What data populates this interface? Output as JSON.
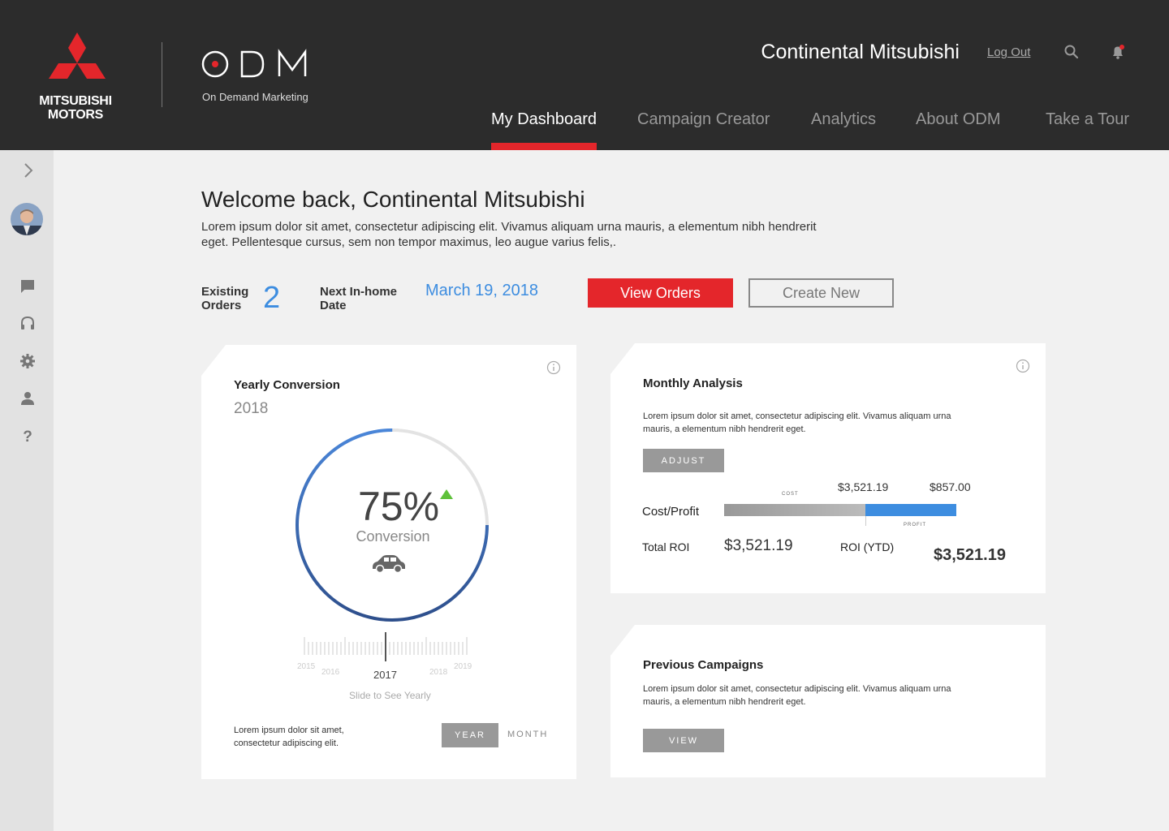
{
  "header": {
    "brand_line1": "MITSUBISHI",
    "brand_line2": "MOTORS",
    "product_tagline": "On Demand Marketing",
    "dealer_name": "Continental Mitsubishi",
    "logout_label": "Log Out",
    "icons": [
      "search-icon",
      "bell-icon"
    ],
    "nav": [
      {
        "label": "My Dashboard",
        "active": true
      },
      {
        "label": "Campaign Creator",
        "active": false
      },
      {
        "label": "Analytics",
        "active": false
      },
      {
        "label": "About ODM",
        "active": false
      },
      {
        "label": "Take a Tour",
        "active": false
      }
    ]
  },
  "sidebar": {
    "icons": [
      "chevron-right-icon",
      "avatar",
      "chat-icon",
      "headset-icon",
      "gear-icon",
      "user-icon",
      "help-icon"
    ]
  },
  "welcome": {
    "title": "Welcome back, Continental Mitsubishi",
    "description": "Lorem ipsum dolor sit amet, consectetur adipiscing elit. Vivamus aliquam urna mauris, a elementum nibh hendrerit eget. Pellentesque cursus, sem non tempor maximus, leo augue varius felis,."
  },
  "stats": {
    "existing_label_1": "Existing",
    "existing_label_2": "Orders",
    "existing_value": "2",
    "next_label_1": "Next In-home",
    "next_label_2": "Date",
    "next_value": "March 19, 2018",
    "view_orders": "View Orders",
    "create_new": "Create New"
  },
  "yearly": {
    "title": "Yearly Conversion",
    "year": "2018",
    "percent": "75%",
    "percent_value": 75,
    "label": "Conversion",
    "slider_years": [
      "2015",
      "2016",
      "2017",
      "2018",
      "2019"
    ],
    "selected_year": "2017",
    "hint": "Slide to See Yearly",
    "footer_text_1": "Lorem ipsum dolor sit amet,",
    "footer_text_2": "consectetur adipiscing elit.",
    "toggle_year": "YEAR",
    "toggle_month": "MONTH"
  },
  "monthly": {
    "title": "Monthly Analysis",
    "desc_1": "Lorem ipsum dolor sit amet, consectetur adipiscing elit. Vivamus aliquam urna",
    "desc_2": "mauris, a elementum nibh hendrerit eget.",
    "adjust": "ADJUST",
    "cost_tag": "COST",
    "profit_tag": "PROFIT",
    "cost_value": "$3,521.19",
    "profit_value": "$857.00",
    "cost_profit_label": "Cost/Profit",
    "total_roi_label": "Total ROI",
    "total_roi_value": "$3,521.19",
    "roi_ytd_label": "ROI (YTD)",
    "roi_ytd_value": "$3,521.19"
  },
  "previous": {
    "title": "Previous Campaigns",
    "desc_1": "Lorem ipsum dolor sit amet, consectetur adipiscing elit. Vivamus aliquam urna",
    "desc_2": "mauris, a elementum nibh hendrerit eget.",
    "view": "VIEW"
  },
  "colors": {
    "accent_red": "#e4262b",
    "accent_blue": "#3d8de0",
    "header_bg": "#2c2c2c"
  }
}
